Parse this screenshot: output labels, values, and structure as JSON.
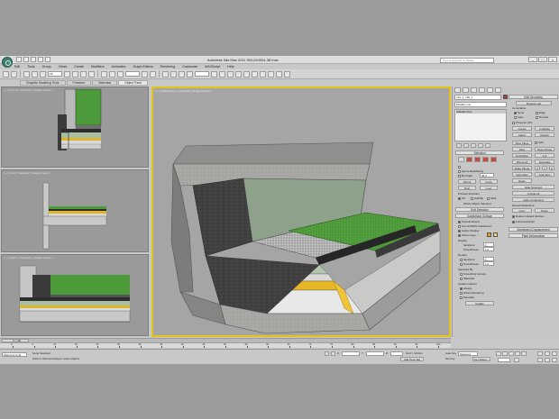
{
  "window": {
    "title": "Autodesk 3ds Max 2011   SM-010004-38.max",
    "search_placeholder": "Type a keyword or phrase"
  },
  "menu": [
    "Edit",
    "Tools",
    "Group",
    "Views",
    "Create",
    "Modifiers",
    "Animation",
    "Graph Editors",
    "Rendering",
    "Customize",
    "MAXScript",
    "Help"
  ],
  "toolbar": {
    "selection_filter": "All"
  },
  "ribbon_tabs": [
    "Graphite Modeling Tools",
    "Freeform",
    "Selection",
    "Object Paint"
  ],
  "viewports": {
    "top_label": "[ + ] [ Front ] [ Realistic ] [ Edged Faces ]",
    "left_label": "[ + ] [ Left ] [ Realistic ] [ Edged Faces ]",
    "right_label": "[ + ] [ Right ] [ Realistic ] [ Edged Faces ]",
    "perspective_label": "[ + ] [ Perspective ] [ Realistic ] [ Edged Faces ]"
  },
  "command_panel": {
    "object_name": "roof_1_100_1",
    "modifier_list": "Modifier List",
    "stack_item": "Editable Poly",
    "selection_title": "Selection",
    "ignore_backfacing": "Ignore Backfacing",
    "by_angle": "By Angle:",
    "angle_value": "45.0",
    "shrink": "Shrink",
    "grow": "Grow",
    "ring": "Ring",
    "loop": "Loop",
    "preview_selection": "Preview Selection",
    "off": "Off",
    "subobj": "SubObj",
    "multi": "Multi",
    "whole_object": "Whole Object Selected",
    "soft_selection": "Soft Selection",
    "edit_geometry": "Edit Geometry",
    "repeat_last": "Repeat Last",
    "constraints": "Constraints",
    "none": "None",
    "edge": "Edge",
    "face": "Face",
    "normal": "Normal",
    "preserve_uvs": "Preserve UVs",
    "create": "Create",
    "collapse": "Collapse",
    "attach": "Attach",
    "detach": "Detach",
    "slice_plane": "Slice Plane",
    "split": "Split",
    "slice": "Slice",
    "reset_plane": "Reset Plane",
    "quickslice": "QuickSlice",
    "cut": "Cut",
    "msmooth": "MSmooth",
    "tessellate": "Tessellate",
    "make_planar": "Make Planar",
    "x": "X",
    "y": "Y",
    "z": "Z",
    "view_align": "View Align",
    "grid_align": "Grid Align",
    "relax": "Relax",
    "hide_selected": "Hide Selected",
    "unhide_all": "Unhide All",
    "hide_unselected": "Hide Unselected",
    "named_selections": "Named Selections:",
    "copy": "Copy",
    "paste": "Paste",
    "delete_isolated": "Delete Isolated Vertices",
    "full_interactivity": "Full Interactivity",
    "subdivision_surface": "Subdivision Surface",
    "smooth_result": "Smooth Result",
    "use_nurms": "Use NURMS Subdivision",
    "isoline_display": "Isoline Display",
    "show_cage": "Show Cage......",
    "display": "Display",
    "iterations": "Iterations:",
    "iterations_value": "1",
    "smoothness": "Smoothness:",
    "smoothness_value": "1.0",
    "render": "Render",
    "separate_by": "Separate By",
    "smoothing_groups": "Smoothing Groups",
    "materials": "Materials",
    "update_options": "Update Options",
    "always": "Always",
    "when_rendering": "When Rendering",
    "manually": "Manually",
    "update": "Update",
    "subdivision_displacement": "Subdivision Displacement",
    "paint_deformation": "Paint Deformation"
  },
  "timeline": {
    "frame": "0 / 100",
    "ticks": [
      "0",
      "5",
      "10",
      "15",
      "20",
      "25",
      "30",
      "35",
      "40",
      "45",
      "50",
      "55",
      "60",
      "65",
      "70",
      "75",
      "80",
      "85",
      "90",
      "95",
      "100"
    ]
  },
  "status": {
    "maxscript": "Welcome to M",
    "selection": "None Selected",
    "prompt": "Click or click-and-drag to select objects",
    "x_label": "X:",
    "y_label": "Y:",
    "z_label": "Z:",
    "grid": "Grid = 10,0cm",
    "add_time_tag": "Add Time Tag",
    "auto_key": "Auto Key",
    "set_key": "Set Key",
    "selected": "Selected",
    "key_filters": "Key Filters..."
  },
  "colors": {
    "grass": "#4f9a3a",
    "insulation": "#e7b528",
    "concrete": "#9a9a98",
    "viewport_border": "#e1c319"
  }
}
